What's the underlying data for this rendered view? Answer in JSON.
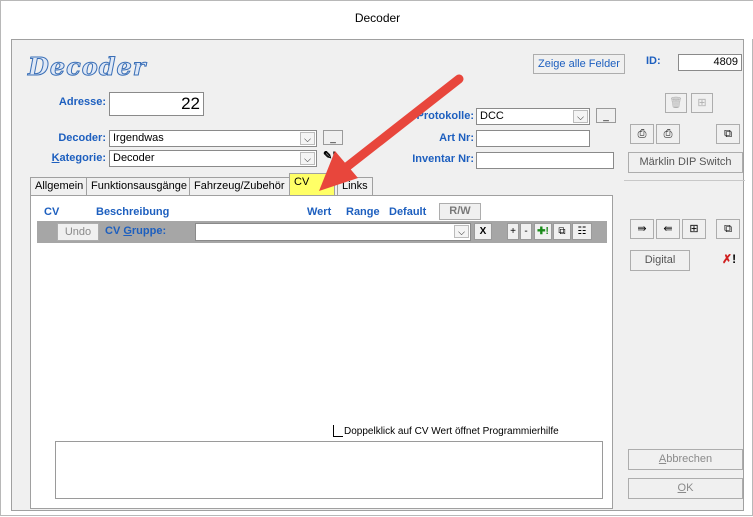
{
  "window": {
    "title": "Decoder"
  },
  "header": {
    "heading": "Decoder",
    "show_all_fields_label": "Zeige alle Felder",
    "id_label": "ID:",
    "id_value": "4809"
  },
  "fields": {
    "adresse_label": "Adresse:",
    "adresse_value": "22",
    "decoder_label": "Decoder:",
    "decoder_value": "Irgendwas",
    "kategorie_label_prefix": "K",
    "kategorie_label_rest": "ategorie:",
    "kategorie_value": "Decoder",
    "protokolle_label": "Protokolle:",
    "protokolle_value": "DCC",
    "artnr_label": "Art Nr:",
    "artnr_value": "",
    "inventar_label": "Inventar Nr:",
    "inventar_value": ""
  },
  "tabs": [
    "Allgemein",
    "Funktionsausgänge",
    "Fahrzeug/Zubehör",
    "CV",
    "Links"
  ],
  "cv_table": {
    "col_cv": "CV",
    "col_beschreibung": "Beschreibung",
    "col_wert": "Wert",
    "col_range": "Range",
    "col_default": "Default",
    "col_rw": "R/W",
    "undo_label": "Undo",
    "gruppe_label_prefix": "CV ",
    "gruppe_label_underlined": "G",
    "gruppe_label_rest": "ruppe:",
    "gruppe_value": "",
    "clear_label": "X",
    "plus_label": "+",
    "minus_label": "-",
    "hint": "Doppelklick auf CV Wert öffnet Programmierhilfe"
  },
  "right_panel": {
    "maerklin_label": "Märklin DIP Switch",
    "digital_label": "Digital",
    "cancel_prefix": "A",
    "cancel_rest": "bbrechen",
    "ok_prefix": "O",
    "ok_rest": "K"
  },
  "colors": {
    "label_blue": "#1d5fbf",
    "active_tab": "#ffff66",
    "arrow_red": "#e8463c"
  }
}
